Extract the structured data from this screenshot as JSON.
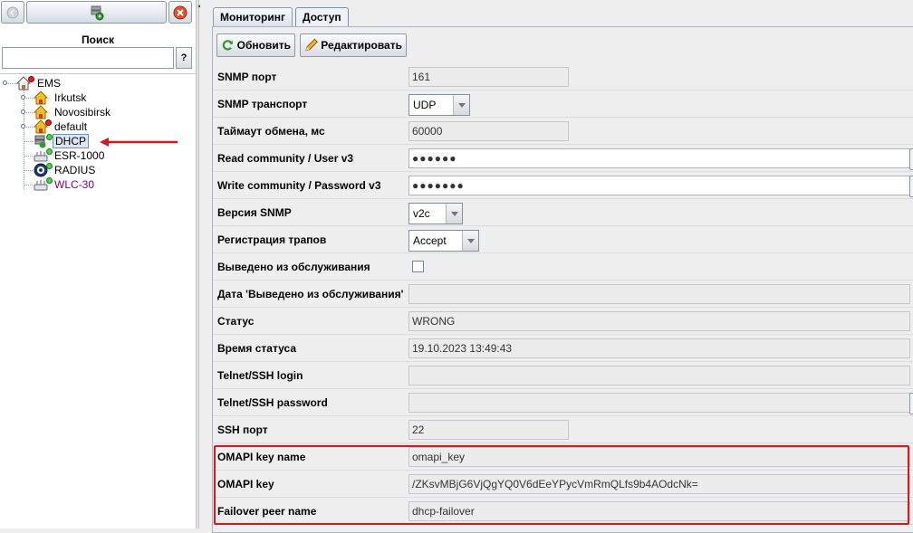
{
  "sidebar": {
    "search_label": "Поиск",
    "search_value": "",
    "help_label": "?",
    "tree": {
      "root": "EMS",
      "groups": [
        "Irkutsk",
        "Novosibirsk",
        "default"
      ],
      "children": [
        {
          "label": "DHCP",
          "selected": true
        },
        {
          "label": "ESR-1000",
          "selected": false
        },
        {
          "label": "RADIUS",
          "selected": false
        },
        {
          "label": "WLC-30",
          "selected": false,
          "color": "#800080"
        }
      ]
    }
  },
  "tabs": [
    {
      "label": "Мониторинг",
      "active": false
    },
    {
      "label": "Доступ",
      "active": true
    }
  ],
  "toolbar": {
    "refresh_label": "Обновить",
    "edit_label": "Редактировать"
  },
  "form": {
    "snmp_port": {
      "label": "SNMP порт",
      "value": "161"
    },
    "snmp_transport": {
      "label": "SNMP транспорт",
      "value": "UDP"
    },
    "timeout": {
      "label": "Таймаут обмена, мс",
      "value": "60000"
    },
    "read_community": {
      "label": "Read community / User v3",
      "value": "●●●●●●"
    },
    "write_community": {
      "label": "Write community / Password v3",
      "value": "●●●●●●●"
    },
    "snmp_version": {
      "label": "Версия SNMP",
      "value": "v2c"
    },
    "trap_registration": {
      "label": "Регистрация трапов",
      "value": "Accept"
    },
    "out_of_service": {
      "label": "Выведено из обслуживания",
      "checked": false
    },
    "out_of_service_date": {
      "label": "Дата 'Выведено из обслуживания'",
      "value": ""
    },
    "status": {
      "label": "Статус",
      "value": "WRONG"
    },
    "status_time": {
      "label": "Время статуса",
      "value": "19.10.2023 13:49:43"
    },
    "telnet_login": {
      "label": "Telnet/SSH login",
      "value": ""
    },
    "telnet_password": {
      "label": "Telnet/SSH password",
      "value": ""
    },
    "ssh_port": {
      "label": "SSH порт",
      "value": "22"
    },
    "omapi_key_name": {
      "label": "OMAPI key name",
      "value": "omapi_key"
    },
    "omapi_key": {
      "label": "OMAPI key",
      "value": "/ZKsvMBjG6VjQgYQ0V6dEeYPycVmRmQLfs9b4AOdcNk="
    },
    "failover_peer": {
      "label": "Failover peer name",
      "value": "dhcp-failover"
    }
  },
  "colors": {
    "highlight": "#e0141b",
    "arrow": "#e0141b"
  }
}
